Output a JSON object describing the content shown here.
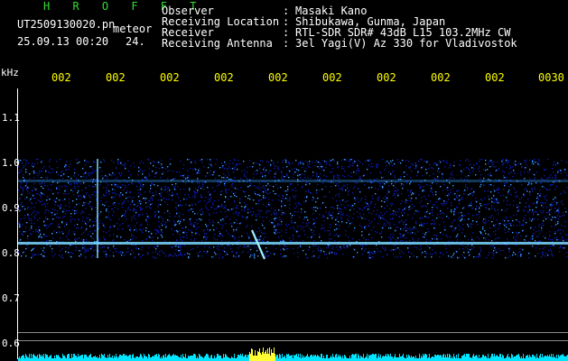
{
  "header": {
    "station": "H R O F F T",
    "filename": "UT2509130020.pn",
    "event_type": "meteor",
    "datetime": "25.09.13 00:20",
    "extra_value": "24.",
    "info_labels": [
      "Observer",
      "Receiving Location",
      "Receiver",
      "Receiving Antenna"
    ],
    "info_separator": ":",
    "info_values": [
      "Masaki Kano",
      "Shibukawa, Gunma, Japan",
      "RTL-SDR SDR# 43dB L15 103.2MHz CW",
      "3el Yagi(V) Az 330 for Vladivostok"
    ]
  },
  "spectrogram": {
    "y_unit": "kHz",
    "y_ticks": [
      "1.1",
      "1.0",
      "0.9",
      "0.8",
      "0.7",
      "0.6"
    ],
    "x_ticks": [
      "002",
      "002",
      "002",
      "002",
      "002",
      "002",
      "002",
      "002",
      "002",
      "0030"
    ],
    "colors": {
      "background": "#000000",
      "noise_low": "#0b1aa8",
      "noise_high": "#3aa0ff",
      "carrier": "#7ad8ff",
      "meteor": "#9ff0ff",
      "amplitude_bars": "#00e5ff",
      "amplitude_peak": "#ffff33"
    }
  }
}
